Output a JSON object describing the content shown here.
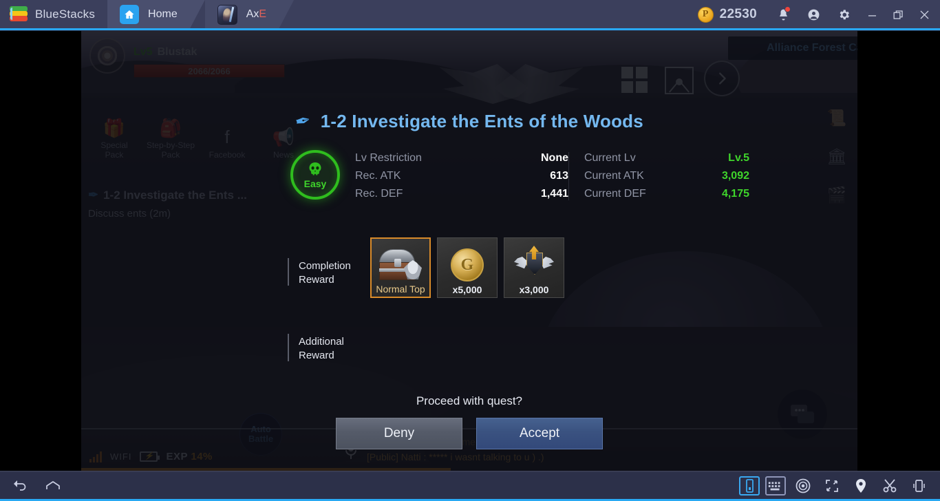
{
  "titlebar": {
    "brand": "BlueStacks",
    "tabs": [
      {
        "label": "Home",
        "icon": "home-icon"
      },
      {
        "label": "AxE",
        "icon": "game-thumbnail"
      }
    ],
    "points": "22530",
    "points_icon": "P",
    "controls": {
      "notifications": "bell-icon",
      "account": "account-icon",
      "settings": "gear-icon",
      "minimize": "minimize-icon",
      "restore": "restore-icon",
      "close": "close-icon"
    }
  },
  "game": {
    "hud": {
      "player_level": "Lv5",
      "player_name": "Blustak",
      "hp_text": "2066/2066",
      "hp_percent": 100,
      "zone_name": "Alliance Forest Camp",
      "auto_battle": {
        "line1": "Auto",
        "line2": "Battle"
      }
    },
    "side_buttons": [
      {
        "label_line1": "Special",
        "label_line2": "Pack",
        "glyph": "🎁"
      },
      {
        "label_line1": "Step-by-Step",
        "label_line2": "Pack",
        "glyph": "🎒"
      },
      {
        "label_line1": "Facebook",
        "label_line2": "",
        "glyph": "f"
      },
      {
        "label_line1": "News",
        "label_line2": "",
        "glyph": "📢"
      }
    ],
    "quest_tracker": {
      "title": "1-2 Investigate the Ents ...",
      "objective": "Discuss ents (2m)"
    },
    "status": {
      "network": "WIFI",
      "exp_label": "EXP",
      "exp_value": "14%",
      "exp_percent": 14
    },
    "chat": [
      "[Public] Father : invite me",
      "[Public] Natti : ***** i wasnt talking to u ) .)"
    ]
  },
  "quest_modal": {
    "title": "1-2 Investigate the Ents of the Woods",
    "difficulty": "Easy",
    "stats_left": [
      {
        "key": "Lv Restriction",
        "value": "None"
      },
      {
        "key": "Rec. ATK",
        "value": "613"
      },
      {
        "key": "Rec. DEF",
        "value": "1,441"
      }
    ],
    "stats_right": [
      {
        "key": "Current Lv",
        "value": "Lv.5"
      },
      {
        "key": "Current ATK",
        "value": "3,092"
      },
      {
        "key": "Current DEF",
        "value": "4,175"
      }
    ],
    "completion_reward_label_line1": "Completion",
    "completion_reward_label_line2": "Reward",
    "additional_reward_label_line1": "Additional",
    "additional_reward_label_line2": "Reward",
    "rewards": [
      {
        "name": "chest-icon",
        "caption": "Normal Top",
        "selected": true
      },
      {
        "name": "gold-coin-icon",
        "caption": "x5,000",
        "selected": false
      },
      {
        "name": "exp-emblem-icon",
        "caption": "x3,000",
        "selected": false
      }
    ],
    "confirm_text": "Proceed with quest?",
    "deny_label": "Deny",
    "accept_label": "Accept"
  },
  "bottombar": {
    "left": [
      {
        "name": "back-icon"
      },
      {
        "name": "home-icon"
      }
    ],
    "right": [
      {
        "name": "rotate-device-icon"
      },
      {
        "name": "keyboard-icon"
      },
      {
        "name": "macro-record-icon"
      },
      {
        "name": "fullscreen-icon"
      },
      {
        "name": "location-icon"
      },
      {
        "name": "screenshot-icon"
      },
      {
        "name": "shake-device-icon"
      }
    ]
  },
  "colors": {
    "accent": "#29a9f3",
    "titlebar": "#3b3f5c",
    "quest_title": "#74b8ef",
    "difficulty_green": "#3fd52b",
    "exp_orange": "#f0941e",
    "accept_blue": "#3a5280"
  }
}
